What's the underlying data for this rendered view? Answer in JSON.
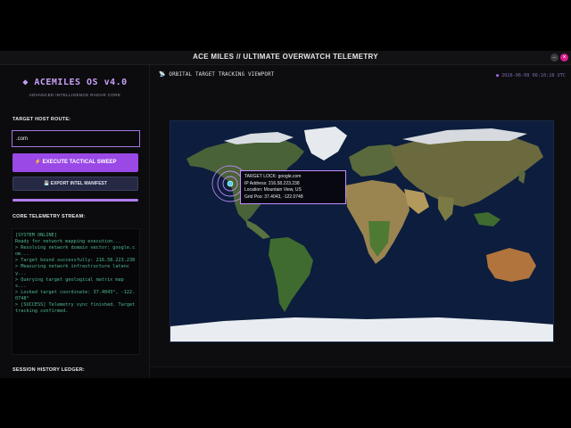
{
  "window": {
    "title": "ACE MILES // ULTIMATE OVERWATCH TELEMETRY",
    "minimize_glyph": "–",
    "close_glyph": "×"
  },
  "sidebar": {
    "brand": "◆ ACEMILES OS v4.0",
    "brand_sub": "ADVANCED INTELLIGENCE RADAR CORE",
    "target_label": "TARGET HOST ROUTE:",
    "target_value": ".com",
    "execute_label": "⚡ EXECUTE TACTICAL SWEEP",
    "export_label": "💾 EXPORT INTEL MANIFEST",
    "progress": 1.0,
    "telemetry_label": "CORE TELEMETRY STREAM:",
    "console_lines": [
      "[SYSTEM ONLINE]",
      "Ready for network mapping execution...",
      "> Resolving network domain vector: google.com...",
      "> Target bound successfully: 216.58.223.238",
      "> Measuring network infrastructure latency...",
      "> Querying target geological matrix map s...",
      "> Locked target coordinate: 37.4043°, -122.0748°",
      "> [SUCCESS] Telemetry sync finished. Target tracking confirmed."
    ],
    "history_label": "SESSION HISTORY LEDGER:"
  },
  "viewport": {
    "icon": "radar-icon",
    "title": "ORBITAL TARGET TRACKING VIEWPORT",
    "timestamp": "2026-06-08 06:10:28 UTC",
    "tooltip": {
      "target": "TARGET LOCK: google.com",
      "ip": "IP Address: 216.58.223.238",
      "location": "Location: Mountain View, US",
      "grid": "Grid Pos: 37.4043, -122.0748"
    }
  },
  "colors": {
    "accent": "#9a48e6",
    "brand": "#c8a0f6",
    "console_text": "#4fb98f",
    "close": "#d81b8a",
    "ocean": "#0c1d3d",
    "target": "#c58cff"
  }
}
